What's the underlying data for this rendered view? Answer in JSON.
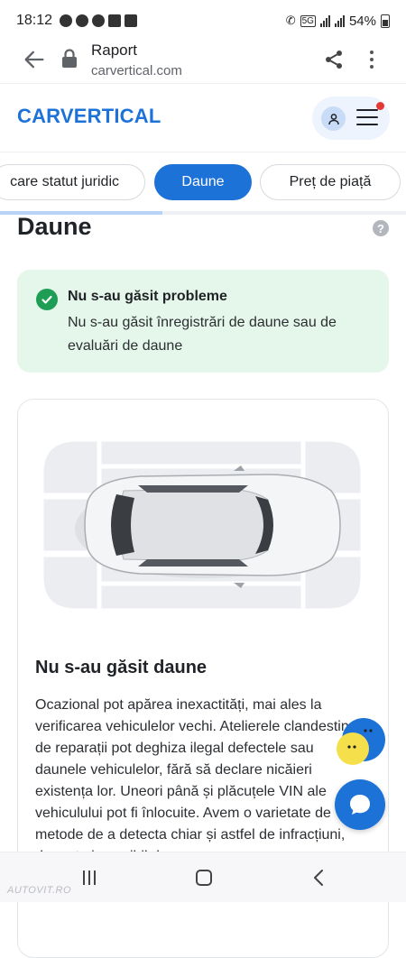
{
  "status_bar": {
    "time": "18:12",
    "network": "5G",
    "battery": "54%"
  },
  "browser": {
    "page_title": "Raport",
    "host": "carvertical.com"
  },
  "site": {
    "logo": "CARVERTICAL"
  },
  "tabs": [
    {
      "label": "care statut juridic",
      "active": false
    },
    {
      "label": "Daune",
      "active": true
    },
    {
      "label": "Preț de piață",
      "active": false
    }
  ],
  "scroll_progress": 0.4,
  "section": {
    "title": "Daune",
    "help": "?"
  },
  "alert": {
    "title": "Nu s-au găsit probleme",
    "body": "Nu s-au găsit înregistrări de daune sau de evaluări de daune"
  },
  "damage_card": {
    "title": "Nu s-au găsit daune",
    "body": "Ocazional pot apărea inexactități, mai ales la verificarea vehiculelor vechi. Atelierele clandestine de reparații pot deghiza ilegal defectele sau daunele vehiculelor, fără să declare nicăieri existența lor. Uneori până și plăcuțele VIN ale vehiculului pot fi înlocuite. Avem o varietate de metode de a detecta chiar și astfel de infracțiuni, dar este imposibil de"
  },
  "watermark": "AUTOVIT.RO",
  "colors": {
    "brand": "#1d72d8",
    "success": "#1e9e55",
    "success_bg": "#e5f6ea"
  }
}
